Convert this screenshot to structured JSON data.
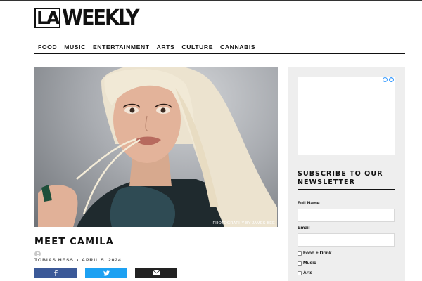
{
  "logo": {
    "part1": "LA",
    "part2": "WEEKLY"
  },
  "nav": [
    "FOOD",
    "MUSIC",
    "ENTERTAINMENT",
    "ARTS",
    "CULTURE",
    "CANNABIS"
  ],
  "hero": {
    "credit": "PHOTOGRAPHY BY JAMES BEE"
  },
  "article": {
    "title": "MEET CAMILA",
    "author": "TOBIAS HESS",
    "separator": "•",
    "date": "APRIL 5, 2024"
  },
  "share": {
    "facebook_icon": "facebook-icon",
    "twitter_icon": "twitter-icon",
    "email_icon": "email-icon"
  },
  "sidebar": {
    "newsletter_title": "SUBSCRIBE TO OUR NEWSLETTER",
    "full_name_label": "Full Name",
    "email_label": "Email",
    "checkboxes": [
      "Food + Drink",
      "Music",
      "Arts"
    ]
  },
  "colors": {
    "facebook": "#3b5998",
    "twitter": "#1da1f2",
    "email": "#222222",
    "sidebar_bg": "#eeeeee"
  }
}
